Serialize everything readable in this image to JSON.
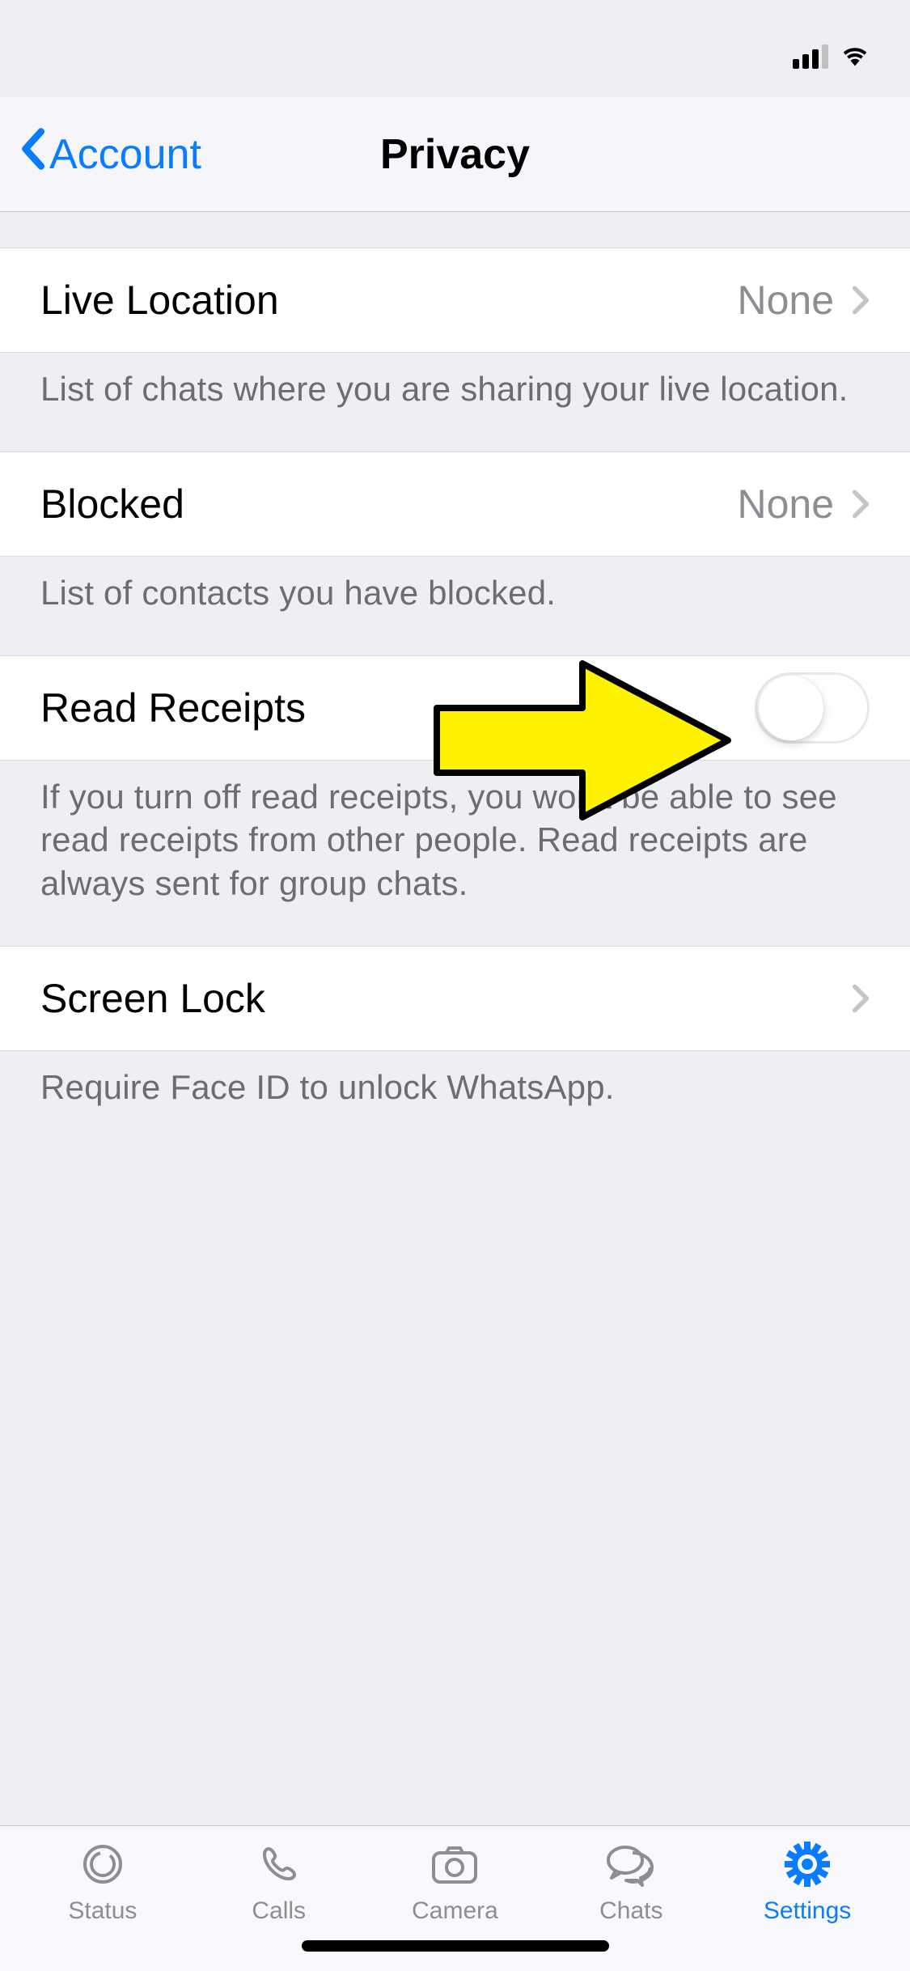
{
  "nav": {
    "back_label": "Account",
    "title": "Privacy"
  },
  "rows": {
    "live_location": {
      "label": "Live Location",
      "value": "None",
      "footer": "List of chats where you are sharing your live location."
    },
    "blocked": {
      "label": "Blocked",
      "value": "None",
      "footer": "List of contacts you have blocked."
    },
    "read_receipts": {
      "label": "Read Receipts",
      "footer": "If you turn off read receipts, you won't be able to see read receipts from other people. Read receipts are always sent for group chats."
    },
    "screen_lock": {
      "label": "Screen Lock",
      "footer": "Require Face ID to unlock WhatsApp."
    }
  },
  "tabs": {
    "status": "Status",
    "calls": "Calls",
    "camera": "Camera",
    "chats": "Chats",
    "settings": "Settings"
  }
}
